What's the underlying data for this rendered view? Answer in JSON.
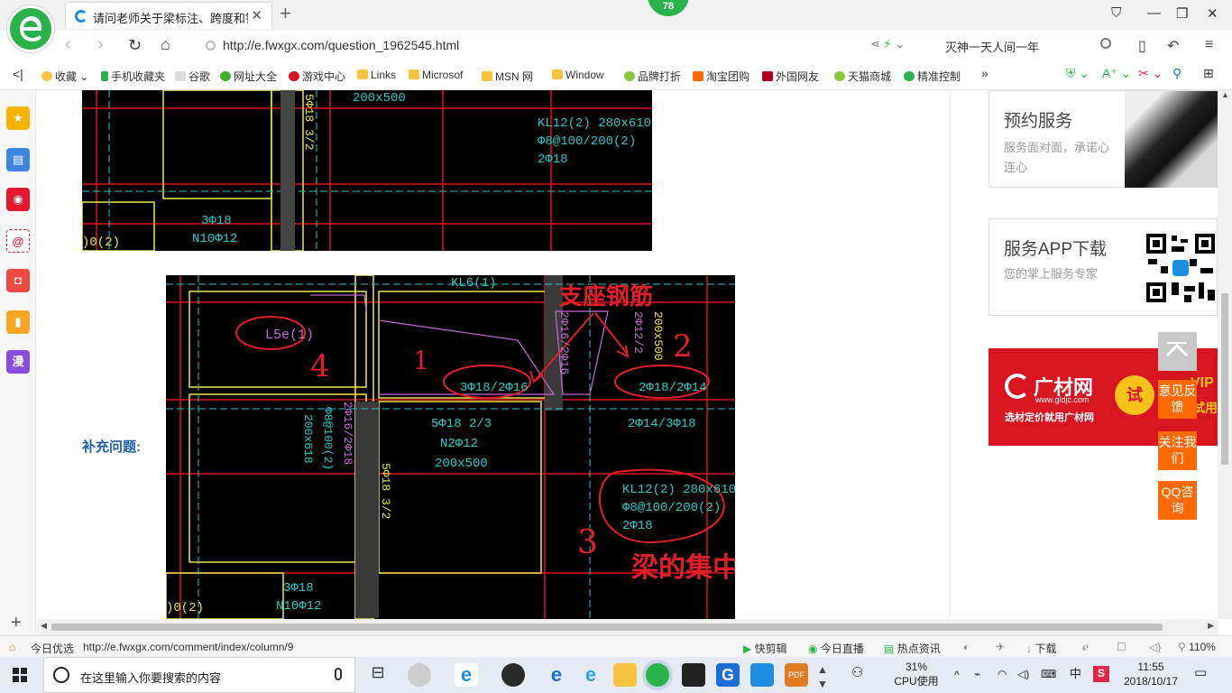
{
  "browser": {
    "tab_title": "请问老师关于梁标注、跨度和钢筋",
    "notification_count": "78",
    "url": "http://e.fwxgx.com/question_1962545.html",
    "search_text": "灭神一天人间一年"
  },
  "bookmarks": [
    {
      "label": "收藏",
      "icon": "star-icon"
    },
    {
      "label": "手机收藏夹",
      "icon": "phone-icon"
    },
    {
      "label": "谷歌",
      "icon": "page-icon"
    },
    {
      "label": "网址大全",
      "icon": "compass-icon"
    },
    {
      "label": "游戏中心",
      "icon": "game-icon"
    },
    {
      "label": "Links",
      "icon": "folder-icon"
    },
    {
      "label": "Microsof",
      "icon": "folder-icon"
    },
    {
      "label": "MSN 网",
      "icon": "folder-icon"
    },
    {
      "label": "Window",
      "icon": "folder-icon"
    },
    {
      "label": "品牌打折",
      "icon": "leaf-icon"
    },
    {
      "label": "淘宝团购",
      "icon": "taobao-icon"
    },
    {
      "label": "外国网友",
      "icon": "flag-icon"
    },
    {
      "label": "天猫商城",
      "icon": "leaf-icon"
    },
    {
      "label": "精准控制",
      "icon": "wechat-icon"
    }
  ],
  "content": {
    "supplement_label": "补充问题:",
    "cad_top": {
      "texts": [
        "200x500",
        "KL12(2) 280x610",
        "Φ8@100/200(2)",
        "2Φ18",
        "3Φ18",
        "N10Φ12",
        "5Φ18 3/2",
        ")0(2)"
      ]
    },
    "cad_main": {
      "texts": [
        "L5e(1)",
        "4",
        "1",
        "3Φ18/2Φ16",
        "2Φ18/2Φ14",
        "2",
        "支座钢筋",
        "5Φ18 2/3",
        "N2Φ12",
        "200x500",
        "2Φ14/3Φ18",
        "KL12(2) 280x610",
        "Φ8@100/200(2)",
        "2Φ18",
        "3",
        "梁的集中标注",
        "Φ8@100(2)",
        "200x618",
        "2Φ16/2Φ18",
        "5Φ18 3/2",
        "3Φ18",
        "N10Φ12",
        ")0(2)",
        "KL6(1)",
        "2Φ16/2Φ16",
        "200x500",
        "2Φ12/2"
      ]
    },
    "sidebar": {
      "service_title": "预约服务",
      "service_desc": "服务面对面，承诺心连心",
      "app_title": "服务APP下载",
      "app_desc": "您的掌上服务专家",
      "ad_brand": "广材网",
      "ad_url": "www.gldjc.com",
      "ad_tagline": "选材定价就用广材网",
      "ad_try": "试",
      "ad_vip": "VIP",
      "ad_use": "试用"
    },
    "float_buttons": [
      "意见反馈",
      "关注我们",
      "QQ咨询"
    ]
  },
  "status": {
    "today_pick": "今日优选",
    "hover_url": "http://e.fwxgx.com/comment/index/column/9",
    "items": [
      "快剪辑",
      "今日直播",
      "热点资讯",
      "下载"
    ],
    "zoom": "110%"
  },
  "taskbar": {
    "search_placeholder": "在这里输入你要搜索的内容",
    "cpu_percent": "31%",
    "cpu_label": "CPU使用",
    "ime": "中",
    "time": "11:55",
    "date": "2018/10/17"
  }
}
